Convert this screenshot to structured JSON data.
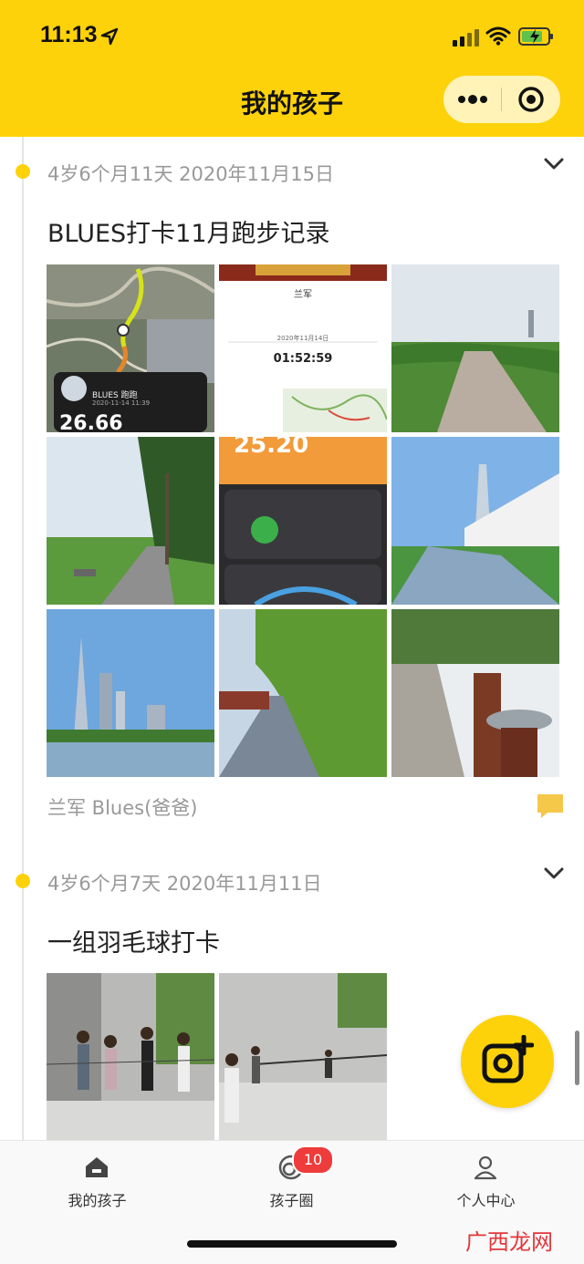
{
  "status_bar": {
    "time": "11:13"
  },
  "nav": {
    "title": "我的孩子"
  },
  "posts": [
    {
      "meta": "4岁6个月11天 2020年11月15日",
      "title": "BLUES打卡11月跑步记录",
      "author": "兰军 Blues(爸爸)",
      "photos": [
        {
          "label": "running-route-map",
          "caption_name": "BLUES 跑跑",
          "caption_date": "2020-11-14 11:39",
          "distance": "26.66"
        },
        {
          "label": "race-certificate",
          "name": "兰军",
          "time": "01:52:59",
          "date": "2020年11月14日"
        },
        {
          "label": "greenway-path"
        },
        {
          "label": "tree-lined-path"
        },
        {
          "label": "training-stats",
          "value": "25.20"
        },
        {
          "label": "modern-building-walkway"
        },
        {
          "label": "city-skyline-lake"
        },
        {
          "label": "grass-path"
        },
        {
          "label": "water-fountain-path"
        }
      ]
    },
    {
      "meta": "4岁6个月7天 2020年11月11日",
      "title": "一组羽毛球打卡",
      "photos": [
        {
          "label": "badminton-group-photo"
        },
        {
          "label": "badminton-play"
        }
      ]
    }
  ],
  "tabbar": {
    "tabs": [
      {
        "label": "我的孩子",
        "icon": "home-icon"
      },
      {
        "label": "孩子圈",
        "icon": "circle-icon",
        "badge": "10"
      },
      {
        "label": "个人中心",
        "icon": "person-icon"
      }
    ]
  },
  "watermark": "广西龙网",
  "colors": {
    "brand_yellow": "#FDD20A",
    "badge_red": "#EE3B3B"
  }
}
